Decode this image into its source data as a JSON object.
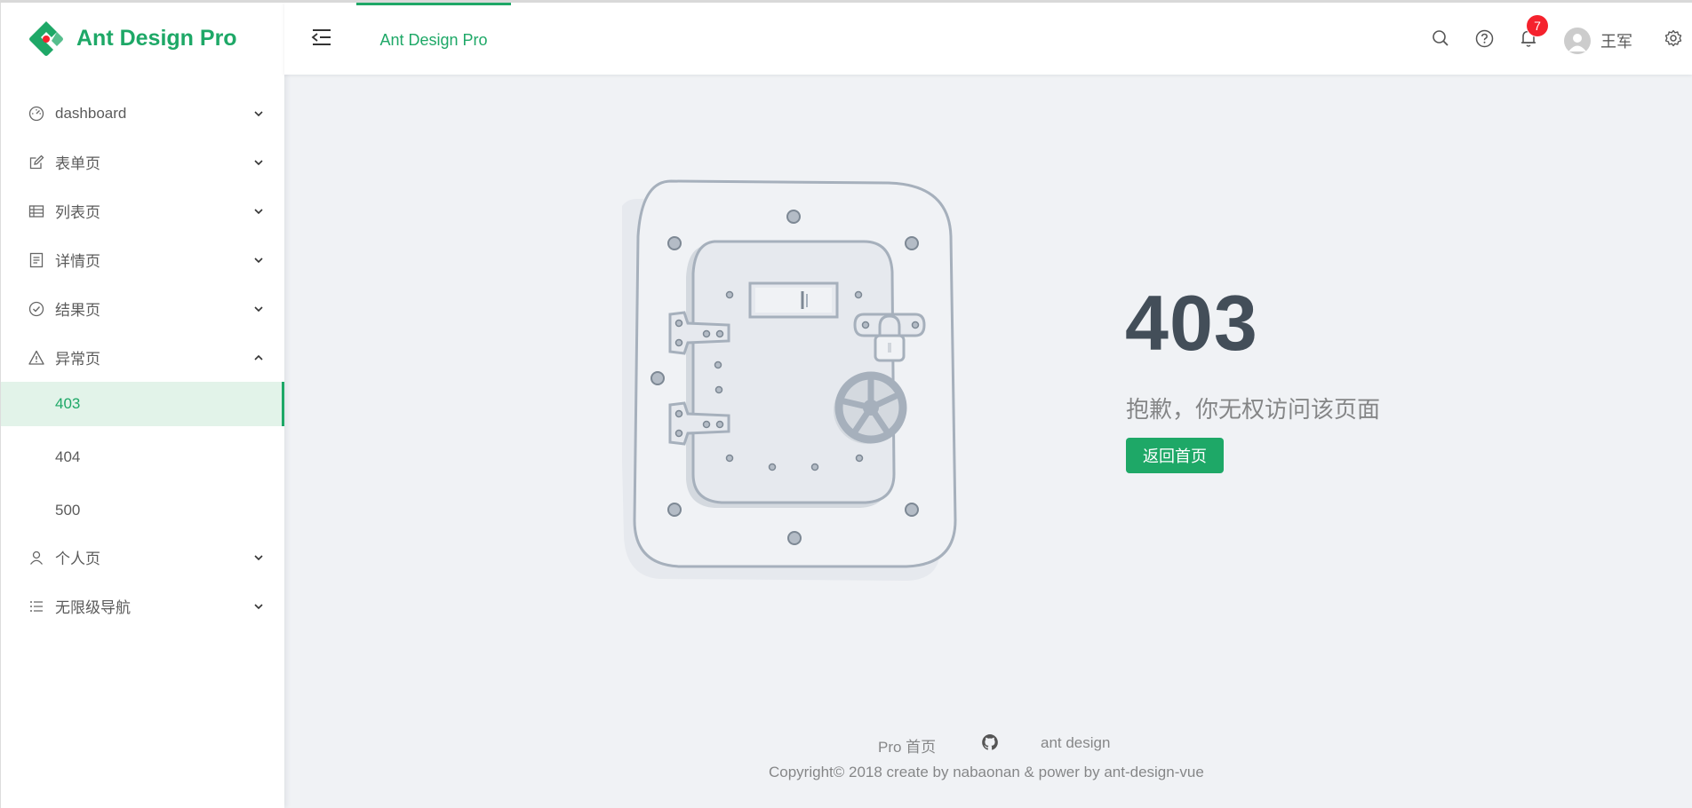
{
  "app": {
    "title": "Ant Design Pro",
    "brand_color": "#1ea867"
  },
  "sidebar": {
    "items": [
      {
        "label": "dashboard",
        "icon": "dashboard-icon",
        "expanded": false
      },
      {
        "label": "表单页",
        "icon": "form-icon",
        "expanded": false
      },
      {
        "label": "列表页",
        "icon": "table-icon",
        "expanded": false
      },
      {
        "label": "详情页",
        "icon": "profile-icon",
        "expanded": false
      },
      {
        "label": "结果页",
        "icon": "check-circle-icon",
        "expanded": false
      },
      {
        "label": "异常页",
        "icon": "warning-icon",
        "expanded": true,
        "children": [
          {
            "label": "403",
            "active": true
          },
          {
            "label": "404",
            "active": false
          },
          {
            "label": "500",
            "active": false
          }
        ]
      },
      {
        "label": "个人页",
        "icon": "user-icon",
        "expanded": false
      },
      {
        "label": "无限级导航",
        "icon": "bars-icon",
        "expanded": false
      }
    ]
  },
  "header": {
    "tab": "Ant Design Pro",
    "notification_count": "7",
    "username": "王军"
  },
  "exception": {
    "code": "403",
    "description": "抱歉，你无权访问该页面",
    "button": "返回首页"
  },
  "footer": {
    "links": [
      "Pro 首页",
      "ant design"
    ],
    "github_icon": "github-icon",
    "copyright": "Copyright© 2018 create by nabaonan & power by ant-design-vue"
  }
}
